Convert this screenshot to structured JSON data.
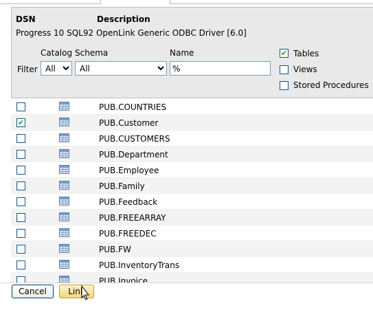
{
  "header": {
    "dsn_label": "DSN",
    "description_label": "Description",
    "dsn_value": "Progress 10 SQL92 OpenLink Generic ODBC Driver [6.0]"
  },
  "filter": {
    "filter_label": "Filter",
    "catalog_label": "Catalog",
    "schema_label": "Schema",
    "name_label": "Name",
    "catalog_value": "All",
    "schema_value": "All",
    "name_value": "%"
  },
  "options": {
    "tables_label": "Tables",
    "views_label": "Views",
    "procs_label": "Stored Procedures",
    "tables_checked": true,
    "views_checked": false,
    "procs_checked": false
  },
  "icons": {
    "table": "table-icon",
    "chevron": "chevron-down-icon",
    "check": "checkmark-icon"
  },
  "rows": [
    {
      "name": "PUB.COUNTRIES",
      "checked": false
    },
    {
      "name": "PUB.Customer",
      "checked": true
    },
    {
      "name": "PUB.CUSTOMERS",
      "checked": false
    },
    {
      "name": "PUB.Department",
      "checked": false
    },
    {
      "name": "PUB.Employee",
      "checked": false
    },
    {
      "name": "PUB.Family",
      "checked": false
    },
    {
      "name": "PUB.Feedback",
      "checked": false
    },
    {
      "name": "PUB.FREEARRAY",
      "checked": false
    },
    {
      "name": "PUB.FREEDEC",
      "checked": false
    },
    {
      "name": "PUB.FW",
      "checked": false
    },
    {
      "name": "PUB.InventoryTrans",
      "checked": false
    },
    {
      "name": "PUB.Invoice",
      "checked": false
    }
  ],
  "buttons": {
    "cancel_label": "Cancel",
    "link_label": "Link"
  },
  "colors": {
    "panel_bg": "#e9e9e9",
    "check_green": "#21a121",
    "alt_row": "#f3f3f3"
  }
}
